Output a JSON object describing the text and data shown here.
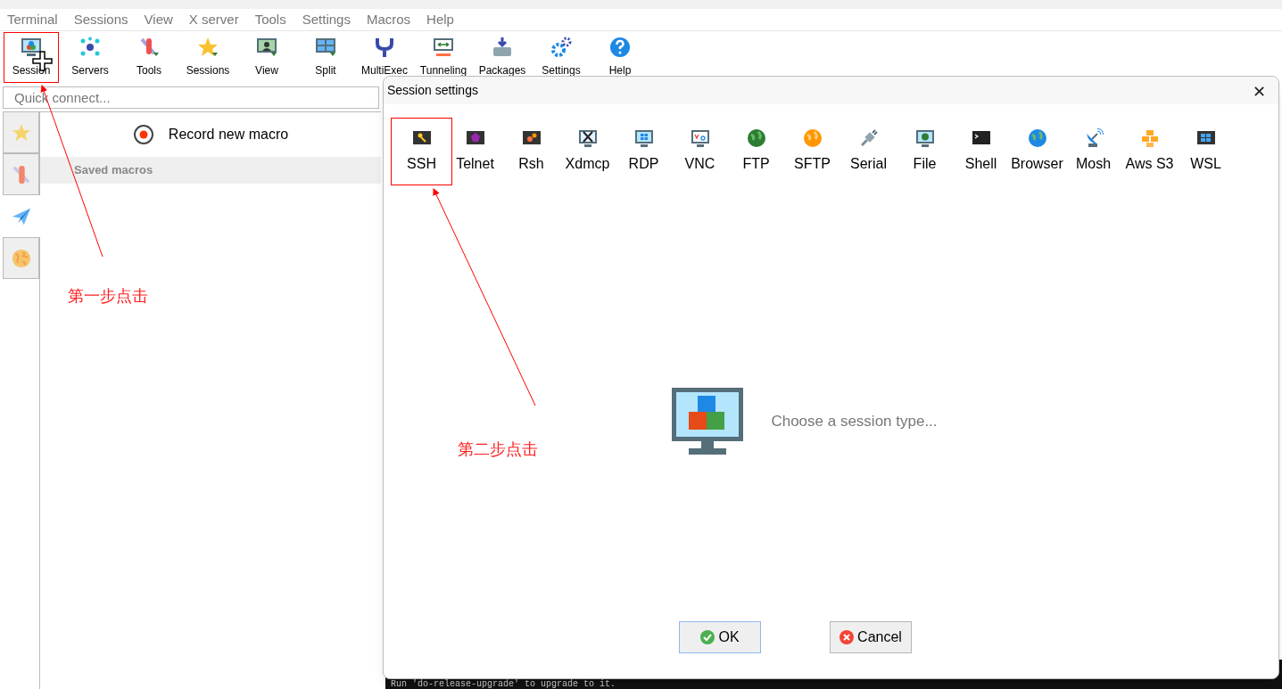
{
  "menu": [
    "Terminal",
    "Sessions",
    "View",
    "X server",
    "Tools",
    "Settings",
    "Macros",
    "Help"
  ],
  "toolbar": [
    {
      "label": "Session",
      "highlighted": true
    },
    {
      "label": "Servers",
      "highlighted": false
    },
    {
      "label": "Tools",
      "highlighted": false
    },
    {
      "label": "Sessions",
      "highlighted": false
    },
    {
      "label": "View",
      "highlighted": false
    },
    {
      "label": "Split",
      "highlighted": false
    },
    {
      "label": "MultiExec",
      "highlighted": false
    },
    {
      "label": "Tunneling",
      "highlighted": false
    },
    {
      "label": "Packages",
      "highlighted": false
    },
    {
      "label": "Settings",
      "highlighted": false
    },
    {
      "label": "Help",
      "highlighted": false
    }
  ],
  "quick_connect": {
    "placeholder": "Quick connect..."
  },
  "side_tabs": [
    {
      "selected": false
    },
    {
      "selected": false
    },
    {
      "selected": true
    },
    {
      "selected": false
    }
  ],
  "macros": {
    "record": "Record new macro",
    "saved_header": "Saved macros"
  },
  "terminal": {
    "text": "Run 'do-release-upgrade' to upgrade to it."
  },
  "dialog": {
    "title": "Session settings",
    "close": "✕",
    "session_types": [
      {
        "label": "SSH",
        "highlighted": true
      },
      {
        "label": "Telnet",
        "highlighted": false
      },
      {
        "label": "Rsh",
        "highlighted": false
      },
      {
        "label": "Xdmcp",
        "highlighted": false
      },
      {
        "label": "RDP",
        "highlighted": false
      },
      {
        "label": "VNC",
        "highlighted": false
      },
      {
        "label": "FTP",
        "highlighted": false
      },
      {
        "label": "SFTP",
        "highlighted": false
      },
      {
        "label": "Serial",
        "highlighted": false
      },
      {
        "label": "File",
        "highlighted": false
      },
      {
        "label": "Shell",
        "highlighted": false
      },
      {
        "label": "Browser",
        "highlighted": false
      },
      {
        "label": "Mosh",
        "highlighted": false
      },
      {
        "label": "Aws S3",
        "highlighted": false
      },
      {
        "label": "WSL",
        "highlighted": false
      }
    ],
    "prompt": "Choose a session type...",
    "buttons": [
      {
        "label": "OK",
        "kind": "ok"
      },
      {
        "label": "Cancel",
        "kind": "cancel"
      }
    ]
  },
  "annotations": [
    {
      "text": "第一步点击"
    },
    {
      "text": "第二步点击"
    }
  ]
}
